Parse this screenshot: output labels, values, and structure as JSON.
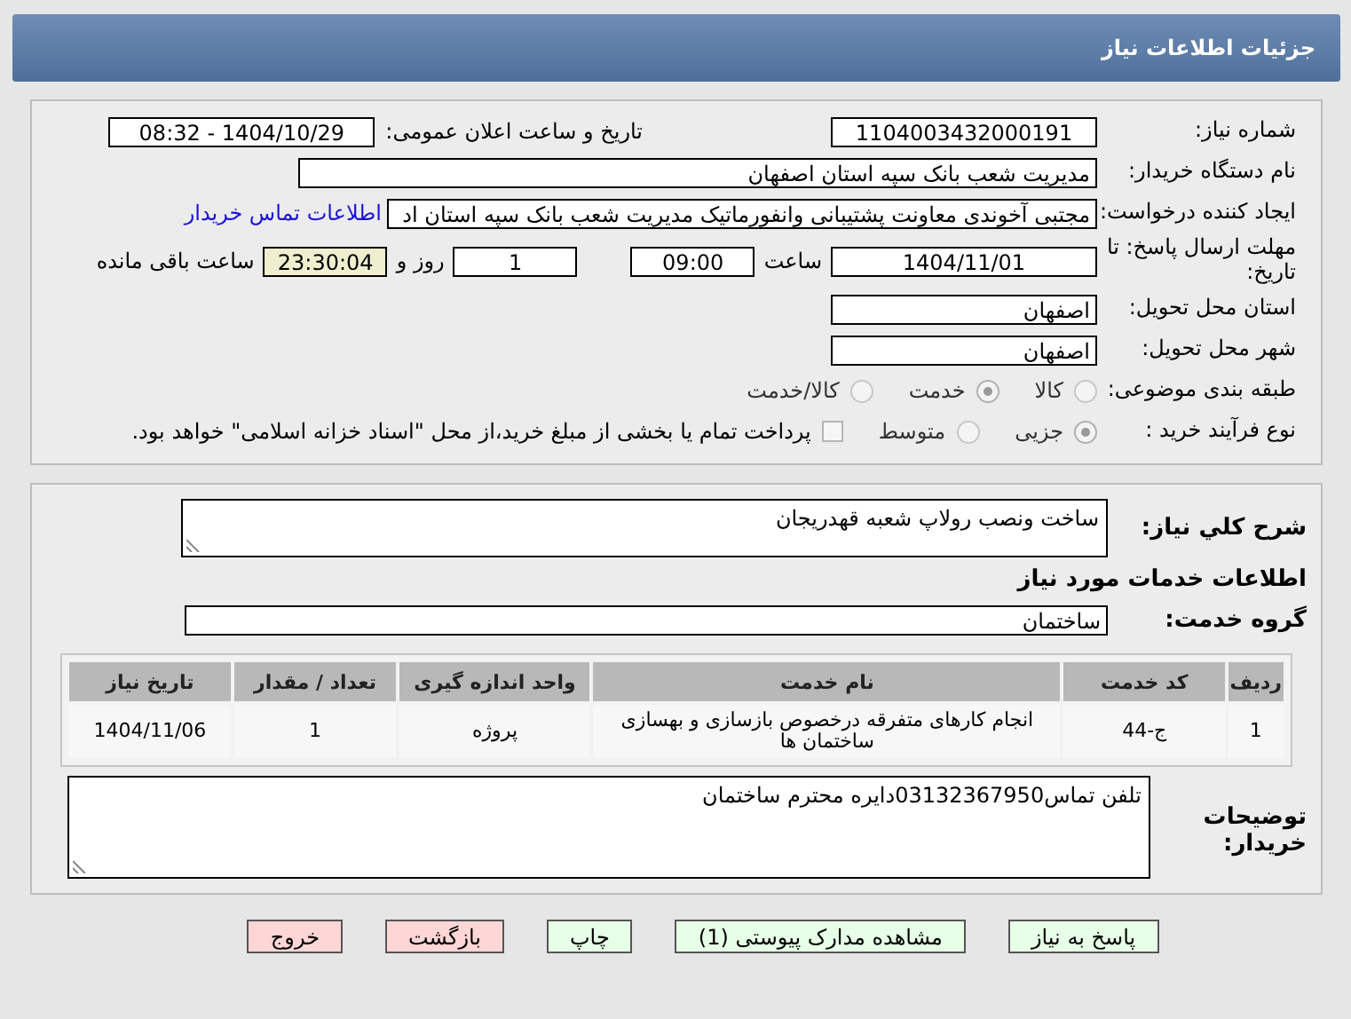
{
  "header": {
    "title": "جزئیات اطلاعات نیاز"
  },
  "need_number": {
    "label": "شماره نیاز:",
    "value": "1104003432000191"
  },
  "announce": {
    "label": "تاریخ و ساعت اعلان عمومی:",
    "value": "1404/10/29 - 08:32"
  },
  "buyer": {
    "label": "نام دستگاه خریدار:",
    "value": "مدیریت شعب بانک سپه استان اصفهان"
  },
  "requester": {
    "label": "ایجاد کننده درخواست:",
    "value": "مجتبی آخوندی معاونت پشتیبانی وانفورماتیک مدیریت شعب بانک سپه استان اد",
    "link": "اطلاعات تماس خریدار"
  },
  "deadline": {
    "label": "مهلت ارسال پاسخ: تا تاریخ:",
    "date": "1404/11/01",
    "time_label": "ساعت",
    "time": "09:00",
    "days": "1",
    "days_label": "روز و",
    "remaining": "23:30:04",
    "remaining_label": "ساعت باقی مانده"
  },
  "province": {
    "label": "استان محل تحویل:",
    "value": "اصفهان"
  },
  "city": {
    "label": "شهر محل تحویل:",
    "value": "اصفهان"
  },
  "category": {
    "label": "طبقه بندی موضوعی:",
    "options": [
      {
        "label": "کالا",
        "selected": false
      },
      {
        "label": "خدمت",
        "selected": true
      },
      {
        "label": "کالا/خدمت",
        "selected": false
      }
    ]
  },
  "process": {
    "label": "نوع فرآیند خرید :",
    "options": [
      {
        "label": "جزیی",
        "selected": true
      },
      {
        "label": "متوسط",
        "selected": false
      }
    ],
    "treasury": {
      "label": "پرداخت تمام یا بخشی از مبلغ خرید،از محل \"اسناد خزانه اسلامی\" خواهد بود.",
      "checked": false
    }
  },
  "description": {
    "label": "شرح کلي نياز:",
    "value": "ساخت ونصب رولاپ شعبه قهدریجان"
  },
  "services_title": "اطلاعات خدمات مورد نیاز",
  "service_group": {
    "label": "گروه خدمت:",
    "value": "ساختمان"
  },
  "table": {
    "columns": [
      "ردیف",
      "کد خدمت",
      "نام خدمت",
      "واحد اندازه گیری",
      "تعداد / مقدار",
      "تاریخ نیاز"
    ],
    "rows": [
      [
        "1",
        "ج-44",
        "انجام کارهای متفرقه درخصوص بازسازی و بهسازی ساختمان ها",
        "پروژه",
        "1",
        "1404/11/06"
      ]
    ]
  },
  "buyer_notes": {
    "label": "توضیحات خریدار:",
    "value": "تلفن تماس03132367950دایره محترم ساختمان"
  },
  "buttons": [
    {
      "label": "پاسخ به نیاز",
      "kind": "action"
    },
    {
      "label": "مشاهده مدارک پیوستی (1)",
      "kind": "action"
    },
    {
      "label": "چاپ",
      "kind": "action"
    },
    {
      "label": "بازگشت",
      "kind": "exit"
    },
    {
      "label": "خروج",
      "kind": "exit"
    }
  ]
}
